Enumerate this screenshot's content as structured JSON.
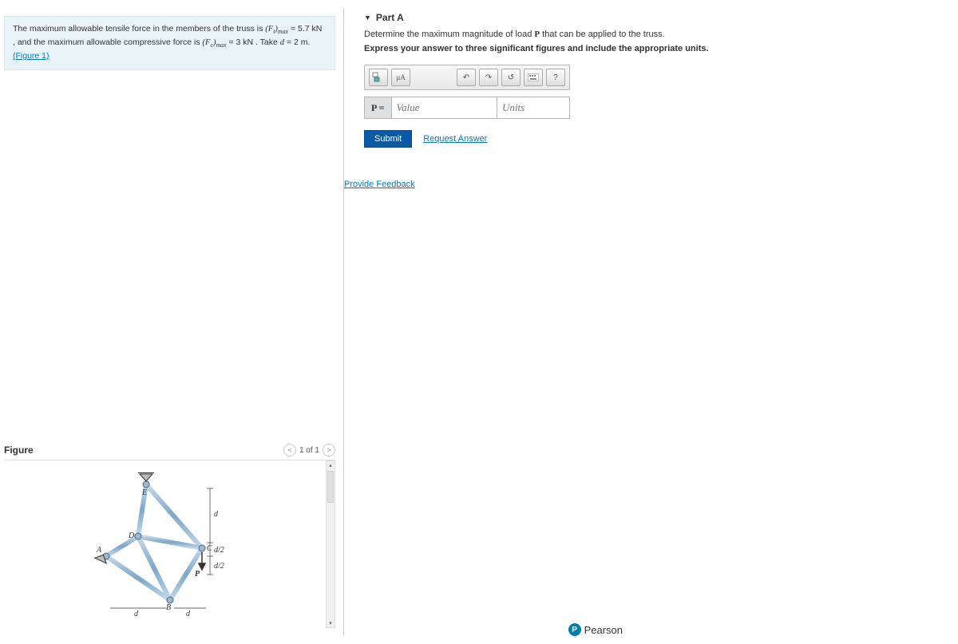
{
  "problem": {
    "text_part1": "The maximum allowable tensile force in the members of the truss is ",
    "ft_expr": "(F_t)_max",
    "ft_val": " = 5.7 kN",
    "text_part2": ", and the maximum allowable compressive force is ",
    "fc_expr": "(F_c)_max",
    "fc_val": " = 3 kN",
    "text_part3": ". Take ",
    "d_expr": "d",
    "d_val": " = 2 m. ",
    "figure_link": "(Figure 1)"
  },
  "figure": {
    "title": "Figure",
    "pager": "1 of 1",
    "labels": {
      "E": "E",
      "D": "D",
      "A": "A",
      "B": "B",
      "C": "C",
      "P": "P",
      "d": "d",
      "d2": "d/2"
    }
  },
  "part": {
    "title": "Part A",
    "instr1a": "Determine the maximum magnitude of load ",
    "instr1b": " that can be applied to the truss.",
    "P": "P",
    "instr2": "Express your answer to three significant figures and include the appropriate units.",
    "toolbar": {
      "units_btn": "µA",
      "help": "?"
    },
    "input": {
      "label": "P =",
      "value_ph": "Value",
      "units_ph": "Units"
    },
    "submit": "Submit",
    "request": "Request Answer"
  },
  "feedback": "Provide Feedback",
  "footer": "Pearson"
}
